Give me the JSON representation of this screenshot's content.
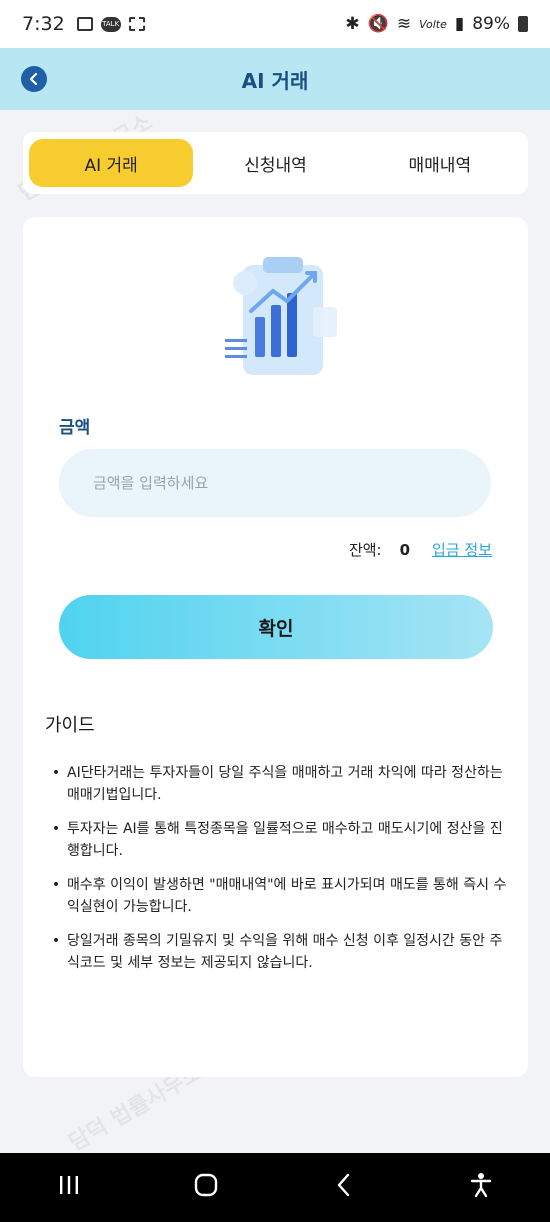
{
  "status_bar": {
    "time": "7:32",
    "talk_badge": "TALK",
    "network": "Volte",
    "battery": "89%"
  },
  "header": {
    "title": "AI 거래",
    "back_icon": "chevron-left-icon"
  },
  "tabs": [
    {
      "label": "AI 거래",
      "active": true
    },
    {
      "label": "신청내역",
      "active": false
    },
    {
      "label": "매매내역",
      "active": false
    }
  ],
  "form": {
    "amount_label": "금액",
    "amount_placeholder": "금액을 입력하세요",
    "amount_value": "",
    "balance_label": "잔액:",
    "balance_value": "0",
    "deposit_link": "입금 정보",
    "confirm_label": "확인"
  },
  "guide": {
    "title": "가이드",
    "items": [
      "AI단타거래는 투자자들이 당일 주식을 매매하고 거래 차익에 따라 정산하는 매매기법입니다.",
      "투자자는 AI를 통해 특정종목을 일률적으로 매수하고 매도시기에 정산을 진행합니다.",
      "매수후 이익이 발생하면 \"매매내역\"에 바로 표시가되며 매도를 통해 즉시 수익실현이 가능합니다.",
      "당일거래 종목의 기밀유지 및 수익을 위해 매수 신청 이후 일정시간 동안 주식코드 및 세부 정보는 제공되지 않습니다."
    ]
  },
  "watermark": "담덕 법률사무소",
  "colors": {
    "header_bg": "#b8e6f2",
    "active_tab": "#f7cc2e",
    "confirm_gradient_start": "#4fd3ef",
    "confirm_gradient_end": "#a6e4f4",
    "link": "#2aa7d6",
    "label": "#1b4f7f"
  }
}
